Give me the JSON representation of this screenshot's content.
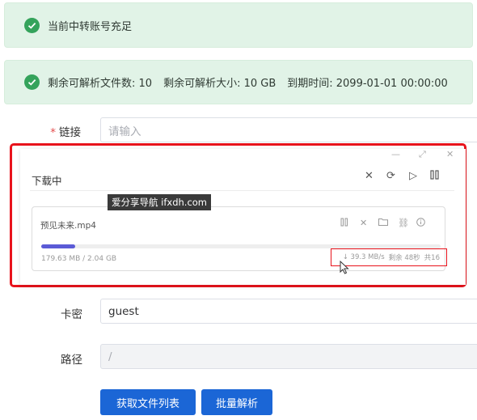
{
  "alerts": {
    "status": "当前中转账号充足",
    "remaining_files": "剩余可解析文件数: 10",
    "remaining_size": "剩余可解析大小: 10 GB",
    "expiry": "到期时间: 2099-01-01 00:00:00"
  },
  "form": {
    "link_label": "链接",
    "link_placeholder": "请输入",
    "card_label": "卡密",
    "card_value": "guest",
    "path_label": "路径",
    "path_value": "/"
  },
  "buttons": {
    "get_list": "获取文件列表",
    "batch_parse": "批量解析"
  },
  "download": {
    "title": "下载中",
    "watermark": "爱分享导航 ifxdh.com",
    "file_name": "预见未来.mp4",
    "size_text": "179.63 MB / 2.04 GB",
    "speed": "↓ 39.3 MB/s",
    "remaining": "剩余 48秒",
    "extra": "共16",
    "progress": 0.086
  },
  "colors": {
    "accent": "#1b66d6",
    "success": "#34a35b",
    "alert_bg": "#e1f3e7",
    "highlight": "#e8131c",
    "progress": "#5b5bd6"
  },
  "icons": [
    "check-circle-icon",
    "close-icon",
    "refresh-icon",
    "play-icon",
    "pause-icon",
    "folder-icon",
    "link-icon",
    "info-icon",
    "minimize-icon",
    "maximize-icon",
    "cursor-icon"
  ]
}
